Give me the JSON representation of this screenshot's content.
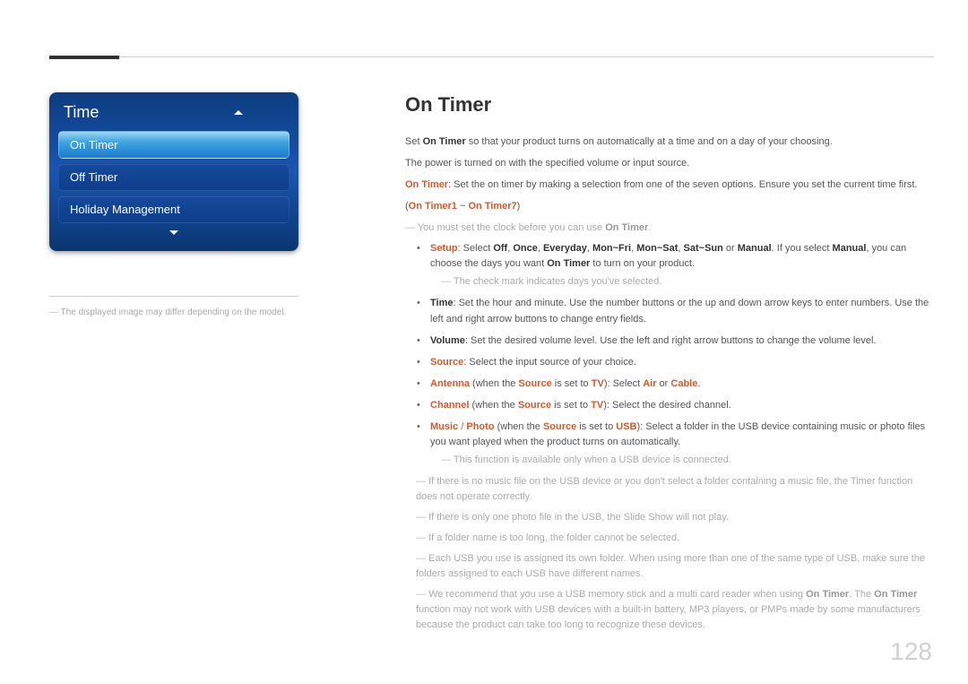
{
  "pageNumber": "128",
  "leftPanel": {
    "title": "Time",
    "items": [
      "On Timer",
      "Off Timer",
      "Holiday Management"
    ],
    "selectedIndex": 0,
    "caption": "The displayed image may differ depending on the model."
  },
  "content": {
    "heading": "On Timer",
    "intro": {
      "pre": "Set ",
      "key": "On Timer",
      "post": " so that your product turns on automatically at a time and on a day of your choosing."
    },
    "power": "The power is turned on with the specified volume or input source.",
    "onTimerDesc": {
      "key": "On Timer",
      "text": ": Set the on timer by making a selection from one of the seven options. Ensure you set the current time first."
    },
    "range": {
      "open": "(",
      "a": "On Timer1",
      "tilde": " ~ ",
      "b": "On Timer7",
      "close": ")"
    },
    "note1": {
      "pre": "You must set the clock before you can use ",
      "key": "On Timer",
      "post": "."
    },
    "bullets": {
      "setup": {
        "key": "Setup",
        "pre": ": Select ",
        "off": "Off",
        ", ": "",
        "once": "Once",
        "everyday": "Everyday",
        "monfri": "Mon~Fri",
        "monsat": "Mon~Sat",
        "satsun": "Sat~Sun",
        "or": " or ",
        "manual": "Manual",
        "tail1": ". If you select ",
        "manual2": "Manual",
        "tail2": ", you can choose the days you want ",
        "ontimer": "On Timer",
        "tail3": " to turn on your product."
      },
      "setupNote": "The check mark indicates days you've selected.",
      "time": {
        "key": "Time",
        "text": ": Set the hour and minute. Use the number buttons or the up and down arrow keys to enter numbers. Use the left and right arrow buttons to change entry fields."
      },
      "volume": {
        "key": "Volume",
        "text": ": Set the desired volume level. Use the left and right arrow buttons to change the volume level."
      },
      "source": {
        "key": "Source",
        "text": ": Select the input source of your choice."
      },
      "antenna": {
        "key": "Antenna",
        "mid1": " (when the ",
        "src": "Source",
        "mid2": " is set to ",
        "tv": "TV",
        "mid3": "): Select ",
        "air": "Air",
        "or": " or ",
        "cable": "Cable",
        "end": "."
      },
      "channel": {
        "key": "Channel",
        "mid1": " (when the ",
        "src": "Source",
        "mid2": " is set to ",
        "tv": "TV",
        "end": "): Select the desired channel."
      },
      "music": {
        "key1": "Music",
        "slash": " / ",
        "key2": "Photo",
        "mid1": " (when the ",
        "src": "Source",
        "mid2": " is set to ",
        "usb": "USB",
        "end": "): Select a folder in the USB device containing music or photo files you want played when the product turns on automatically."
      },
      "musicNote": "This function is available only when a USB device is connected."
    },
    "notes": {
      "n1": "If there is no music file on the USB device or you don't select a folder containing a music file, the Timer function does not operate correctly.",
      "n2": "If there is only one photo file in the USB, the Slide Show will not play.",
      "n3": "If a folder name is too long, the folder cannot be selected.",
      "n4": "Each USB you use is assigned its own folder. When using more than one of the same type of USB, make sure the folders assigned to each USB have different names.",
      "n5": {
        "pre": "We recommend that you use a USB memory stick and a multi card reader when using ",
        "k1": "On Timer",
        "mid": ". The ",
        "k2": "On Timer",
        "post": " function may not work with USB devices with a built-in battery, MP3 players, or PMPs made by some manufacturers because the product can take too long to recognize these devices."
      }
    }
  }
}
